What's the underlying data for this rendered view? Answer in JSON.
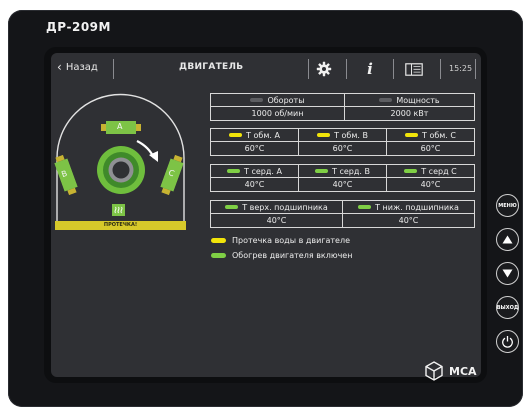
{
  "device": {
    "model": "ДР-209М",
    "brand": "МСА"
  },
  "topbar": {
    "back_label": "Назад",
    "title": "ДВИГАТЕЛЬ",
    "time": "15:25",
    "icons": [
      "gear-icon",
      "info-icon",
      "panel-icon"
    ]
  },
  "schematic": {
    "phase_a": "A",
    "phase_b": "B",
    "phase_c": "C",
    "heater_icon": "heater-icon",
    "leak_label": "ПРОТЕЧКА!"
  },
  "speed_power": {
    "speed_label": "Обороты",
    "speed_value": "1000 об/мин",
    "power_label": "Мощность",
    "power_value": "2000 кВт"
  },
  "winding": [
    {
      "label": "Т обм. А",
      "value": "60°C",
      "status": "yellow"
    },
    {
      "label": "Т обм. В",
      "value": "60°C",
      "status": "yellow"
    },
    {
      "label": "Т обм. С",
      "value": "60°C",
      "status": "yellow"
    }
  ],
  "core": [
    {
      "label": "Т серд. А",
      "value": "40°C",
      "status": "green"
    },
    {
      "label": "Т серд. В",
      "value": "40°C",
      "status": "green"
    },
    {
      "label": "Т серд С",
      "value": "40°C",
      "status": "green"
    }
  ],
  "bearings": [
    {
      "label": "Т верх. подшипника",
      "value": "40°C",
      "status": "green"
    },
    {
      "label": "Т ниж. подшипника",
      "value": "40°C",
      "status": "green"
    }
  ],
  "legend": [
    {
      "text": "Протечка воды в двигателе",
      "color": "yellow"
    },
    {
      "text": "Обогрев двигателя включен",
      "color": "green"
    }
  ],
  "side_buttons": {
    "menu": "МЕНЮ",
    "exit": "ВЫХОД",
    "up_icon": "arrow-up-icon",
    "down_icon": "arrow-down-icon",
    "power_icon": "power-icon"
  },
  "colors": {
    "yellow": "#f1e40a",
    "green": "#7fcf45",
    "gray": "#5d5e62",
    "screen_bg": "#2f3034"
  }
}
